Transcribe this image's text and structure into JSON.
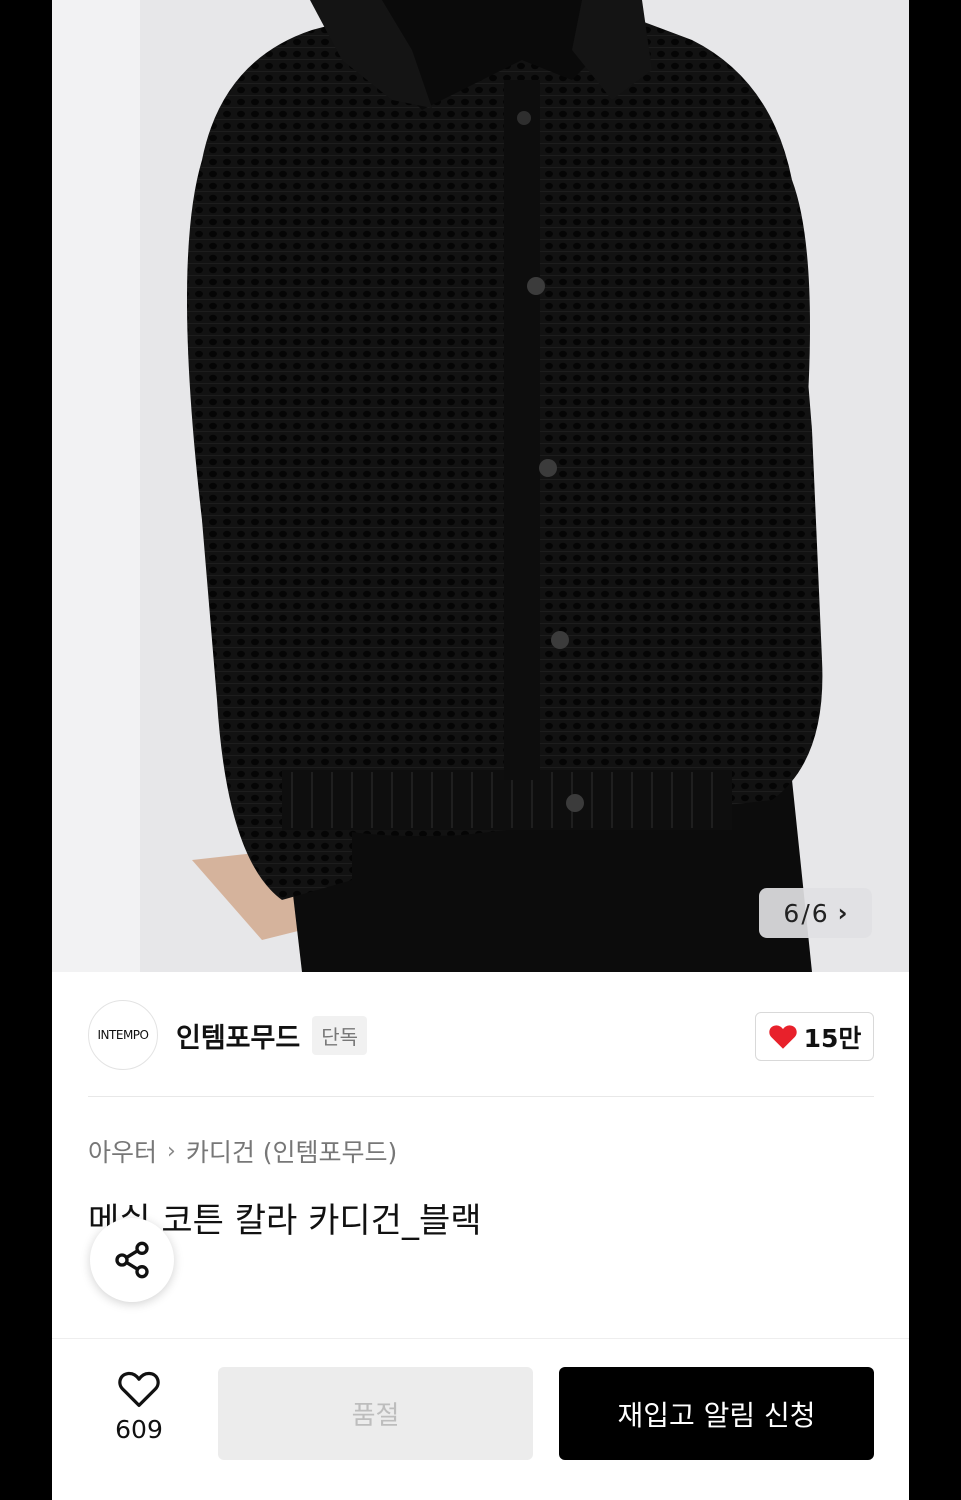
{
  "product_image": {
    "counter_current": "6",
    "counter_separator": "/",
    "counter_total": "6",
    "background_color": "#e7e7e9",
    "garment_color": "#111111"
  },
  "brand": {
    "logo_text": "INTEMPO",
    "name": "인템포무드",
    "badge": "단독",
    "likes": "15만"
  },
  "breadcrumb": {
    "level1": "아우터",
    "level2": "카디건 (인템포무드)"
  },
  "product": {
    "title": "메쉬 코튼 칼라 카디건_블랙"
  },
  "bottom_bar": {
    "wish_count": "609",
    "soldout_label": "품절",
    "restock_label": "재입고 알림 신청"
  },
  "colors": {
    "accent_red": "#e8212b",
    "primary_button": "#000000",
    "disabled_button": "#ececec"
  }
}
